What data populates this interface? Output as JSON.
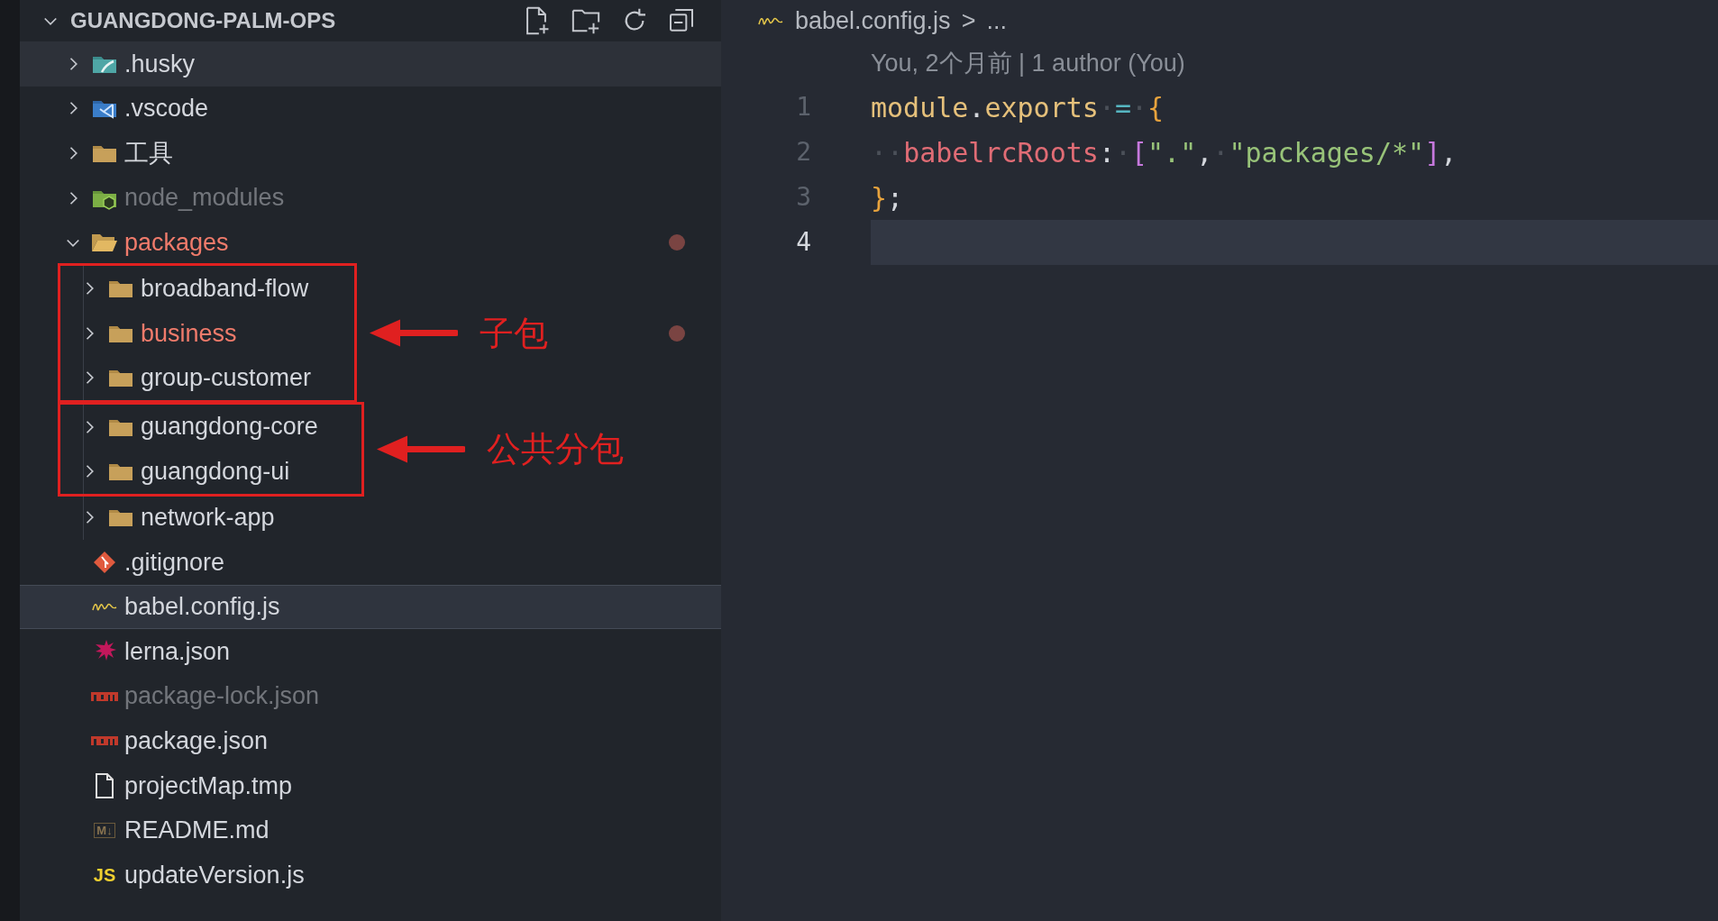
{
  "explorer": {
    "title": "GUANGDONG-PALM-OPS",
    "expanded": true,
    "tree": [
      {
        "kind": "huskyfolder",
        "name": ".husky",
        "expanded": false,
        "hovered": true,
        "selected": false,
        "modified": false,
        "dimmed": false
      },
      {
        "kind": "vscodefolder",
        "name": ".vscode",
        "expanded": false,
        "hovered": false,
        "selected": false,
        "modified": false,
        "dimmed": false
      },
      {
        "kind": "folder",
        "name": "工具",
        "expanded": false,
        "hovered": false,
        "selected": false,
        "modified": false,
        "dimmed": false
      },
      {
        "kind": "nodefolder",
        "name": "node_modules",
        "expanded": false,
        "hovered": false,
        "selected": false,
        "modified": false,
        "dimmed": true
      },
      {
        "kind": "folder",
        "name": "packages",
        "expanded": true,
        "hovered": false,
        "selected": false,
        "modified": true,
        "dimmed": false,
        "children": [
          {
            "kind": "annotation",
            "label": "子包",
            "children": [
              {
                "kind": "folder",
                "name": "broadband-flow",
                "expanded": false,
                "hovered": false,
                "selected": false,
                "modified": false,
                "dimmed": false
              },
              {
                "kind": "folder",
                "name": "business",
                "expanded": false,
                "hovered": false,
                "selected": false,
                "modified": true,
                "dimmed": false
              },
              {
                "kind": "folder",
                "name": "group-customer",
                "expanded": false,
                "hovered": false,
                "selected": false,
                "modified": false,
                "dimmed": false
              }
            ]
          },
          {
            "kind": "annotation",
            "label": "公共分包",
            "children": [
              {
                "kind": "folder",
                "name": "guangdong-core",
                "expanded": false,
                "hovered": false,
                "selected": false,
                "modified": false,
                "dimmed": false
              },
              {
                "kind": "folder",
                "name": "guangdong-ui",
                "expanded": false,
                "hovered": false,
                "selected": false,
                "modified": false,
                "dimmed": false
              }
            ]
          },
          {
            "kind": "folder",
            "name": "network-app",
            "expanded": false,
            "hovered": false,
            "selected": false,
            "modified": false,
            "dimmed": false
          }
        ]
      },
      {
        "kind": "gitfile",
        "name": ".gitignore",
        "hovered": false,
        "selected": false,
        "modified": false,
        "dimmed": false
      },
      {
        "kind": "babelfile",
        "name": "babel.config.js",
        "hovered": false,
        "selected": true,
        "modified": false,
        "dimmed": false
      },
      {
        "kind": "lernafile",
        "name": "lerna.json",
        "hovered": false,
        "selected": false,
        "modified": false,
        "dimmed": false
      },
      {
        "kind": "npmfile",
        "name": "package-lock.json",
        "hovered": false,
        "selected": false,
        "modified": false,
        "dimmed": true
      },
      {
        "kind": "npmfile",
        "name": "package.json",
        "hovered": false,
        "selected": false,
        "modified": false,
        "dimmed": false
      },
      {
        "kind": "plainfile",
        "name": "projectMap.tmp",
        "hovered": false,
        "selected": false,
        "modified": false,
        "dimmed": false
      },
      {
        "kind": "mdfile",
        "name": "README.md",
        "icon_text": "M↓",
        "hovered": false,
        "selected": false,
        "modified": false,
        "dimmed": false
      },
      {
        "kind": "jsfile",
        "name": "updateVersion.js",
        "icon_text": "JS",
        "hovered": false,
        "selected": false,
        "modified": false,
        "dimmed": false
      }
    ]
  },
  "editor": {
    "breadcrumb": {
      "file": "babel.config.js",
      "separator": ">",
      "rest": "..."
    },
    "codelens": "You, 2个月前 | 1 author (You)",
    "lines": [
      {
        "number": "1",
        "current": false,
        "tokens": [
          {
            "kind": "variable",
            "text": "module"
          },
          {
            "kind": "punct",
            "text": "."
          },
          {
            "kind": "variable",
            "text": "exports"
          },
          {
            "kind": "space",
            "text": "·"
          },
          {
            "kind": "operator",
            "text": "="
          },
          {
            "kind": "space",
            "text": "·"
          },
          {
            "kind": "brace",
            "text": "{"
          }
        ]
      },
      {
        "number": "2",
        "current": false,
        "tokens": [
          {
            "kind": "space",
            "text": "··"
          },
          {
            "kind": "property",
            "text": "babelrcRoots"
          },
          {
            "kind": "punct",
            "text": ":"
          },
          {
            "kind": "space",
            "text": "·"
          },
          {
            "kind": "bracket",
            "text": "["
          },
          {
            "kind": "string",
            "text": "\".\""
          },
          {
            "kind": "punct",
            "text": ","
          },
          {
            "kind": "space",
            "text": "·"
          },
          {
            "kind": "string",
            "text": "\"packages/*\""
          },
          {
            "kind": "bracket",
            "text": "]"
          },
          {
            "kind": "punct",
            "text": ","
          }
        ]
      },
      {
        "number": "3",
        "current": false,
        "tokens": [
          {
            "kind": "brace",
            "text": "}"
          },
          {
            "kind": "punct",
            "text": ";"
          }
        ]
      },
      {
        "number": "4",
        "current": true
      }
    ]
  }
}
